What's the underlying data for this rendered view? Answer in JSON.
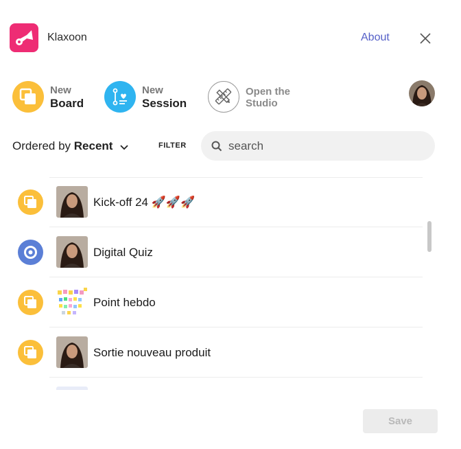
{
  "header": {
    "app_name": "Klaxoon",
    "about_label": "About",
    "close_icon": "close-icon"
  },
  "actions": {
    "new_board": {
      "line1": "New",
      "line2": "Board",
      "color": "#fbbf3a"
    },
    "new_session": {
      "line1": "New",
      "line2": "Session",
      "color": "#2fb4f0"
    },
    "studio": {
      "line1": "Open the",
      "line2": "Studio"
    }
  },
  "sort": {
    "prefix": "Ordered by",
    "value": "Recent"
  },
  "filter_label": "FILTER",
  "search": {
    "placeholder": "search",
    "value": ""
  },
  "items": [
    {
      "title": "Kick-off 24 🚀🚀🚀",
      "type": "board",
      "thumb": "person-photo"
    },
    {
      "title": "Digital Quiz",
      "type": "session",
      "thumb": "person-photo"
    },
    {
      "title": "Point hebdo",
      "type": "board",
      "thumb": "sticky-notes-board"
    },
    {
      "title": "Sortie nouveau produit",
      "type": "board",
      "thumb": "person-photo"
    }
  ],
  "save_label": "Save",
  "colors": {
    "brand": "#ee2c74",
    "link": "#5560c8",
    "board": "#fbbf3a",
    "session": "#5b7fd6"
  }
}
